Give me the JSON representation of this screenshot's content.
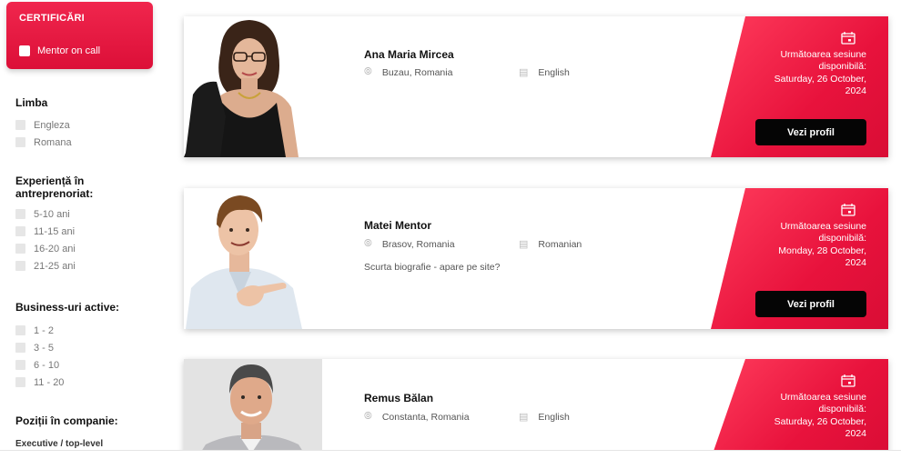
{
  "sidebar": {
    "certificari": {
      "title": "CERTIFICĂRI",
      "option": "Mentor on call"
    },
    "limba": {
      "title": "Limba",
      "options": [
        "Engleza",
        "Romana"
      ]
    },
    "experienta": {
      "title_line1": "Experiență în",
      "title_line2": "antreprenoriat:",
      "options": [
        "5-10 ani",
        "11-15 ani",
        "16-20 ani",
        "21-25 ani"
      ]
    },
    "business": {
      "title": "Business-uri active:",
      "options": [
        "1 - 2",
        "3 - 5",
        "6 - 10",
        "11 - 20"
      ]
    },
    "pozitii": {
      "title": "Poziții în companie:",
      "first_option": "Executive / top-level"
    }
  },
  "mentors": [
    {
      "name": "Ana Maria Mircea",
      "location": "Buzau, Romania",
      "language": "English",
      "session_label_1": "Următoarea sesiune",
      "session_label_2": "disponibilă:",
      "session_date_1": "Saturday, 26 October,",
      "session_date_2": "2024",
      "button": "Vezi profil"
    },
    {
      "name": "Matei Mentor",
      "location": "Brasov, Romania",
      "language": "Romanian",
      "bio": "Scurta biografie - apare pe site?",
      "session_label_1": "Următoarea sesiune",
      "session_label_2": "disponibilă:",
      "session_date_1": "Monday, 28 October,",
      "session_date_2": "2024",
      "button": "Vezi profil"
    },
    {
      "name": "Remus Bălan",
      "location": "Constanta, Romania",
      "language": "English",
      "session_label_1": "Următoarea sesiune",
      "session_label_2": "disponibilă:",
      "session_date_1": "Saturday, 26 October,",
      "session_date_2": "2024"
    }
  ],
  "icons": {
    "location": "map-pin-icon",
    "language": "chat-bubble-icon",
    "calendar": "calendar-icon"
  },
  "colors": {
    "accent": "#e8123c",
    "button": "#050505"
  }
}
